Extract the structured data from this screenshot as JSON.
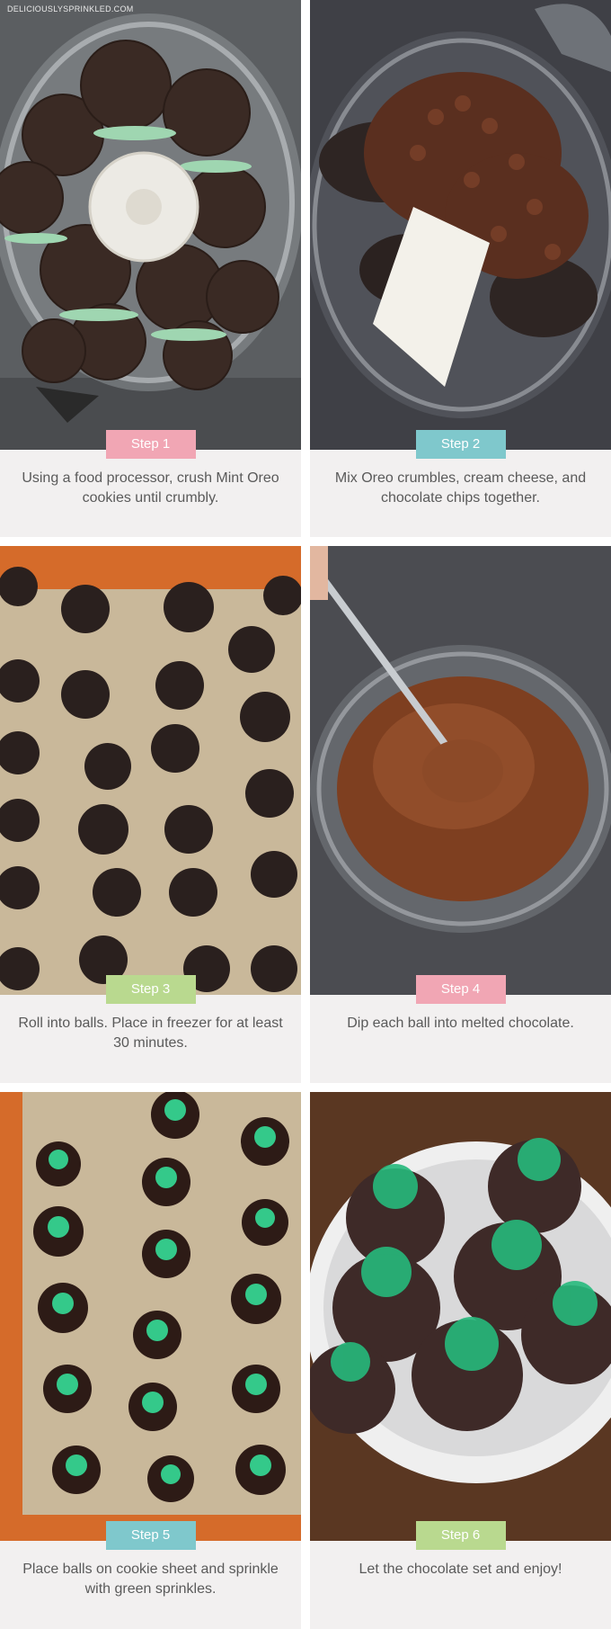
{
  "watermark": "DELICIOUSLYSPRINKLED.COM",
  "colors": {
    "caption_bg": "#f2f0f0",
    "pink": "#f1a6b4",
    "teal": "#7fc8cc",
    "green": "#b9d98f"
  },
  "steps": [
    {
      "badge": "Step 1",
      "caption": "Using a food processor, crush Mint Oreo cookies until crumbly.",
      "badge_color": "pink"
    },
    {
      "badge": "Step 2",
      "caption": "Mix Oreo crumbles, cream cheese, and chocolate chips together.",
      "badge_color": "teal"
    },
    {
      "badge": "Step 3",
      "caption": "Roll into balls. Place in freezer for at least 30 minutes.",
      "badge_color": "green"
    },
    {
      "badge": "Step 4",
      "caption": "Dip each ball into melted chocolate.",
      "badge_color": "pink"
    },
    {
      "badge": "Step 5",
      "caption": "Place balls on cookie sheet and sprinkle with green sprinkles.",
      "badge_color": "teal"
    },
    {
      "badge": "Step 6",
      "caption": "Let the chocolate set and enjoy!",
      "badge_color": "green"
    }
  ]
}
